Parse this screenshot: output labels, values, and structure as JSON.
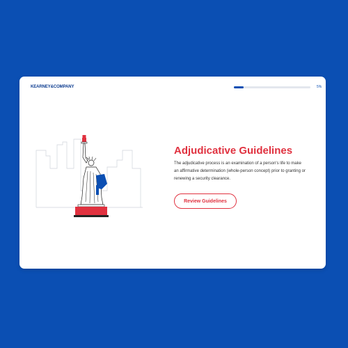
{
  "brand": {
    "logo_text": "KEARNEY&COMPANY"
  },
  "progress": {
    "percent": 5,
    "label": "5%"
  },
  "content": {
    "title": "Adjudicative Guidelines",
    "description": "The adjudicative process is an examination of a person's life to make an affirmative determination (whole-person concept) prior to granting or renewing a security clearance.",
    "button_label": "Review Guidelines"
  },
  "illustration": {
    "icon": "statue-of-liberty-icon"
  },
  "colors": {
    "background": "#0b4fb3",
    "accent": "#e0313f",
    "brand": "#0b3b8f",
    "progress": "#0b4fb3"
  }
}
